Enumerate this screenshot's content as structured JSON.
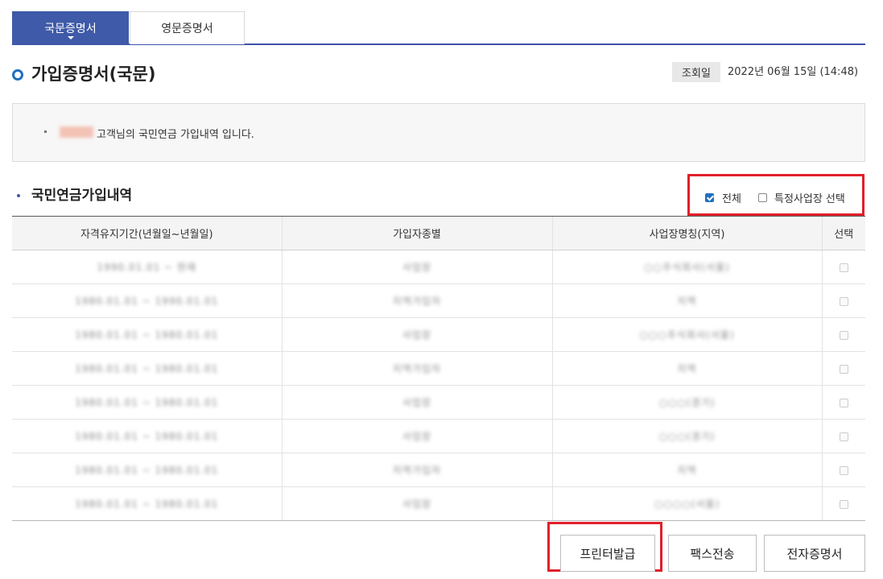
{
  "tabs": [
    {
      "label": "국문증명서",
      "active": true
    },
    {
      "label": "영문증명서",
      "active": false
    }
  ],
  "page_title": "가입증명서(국문)",
  "view": {
    "badge": "조회일",
    "date": "2022년 06월 15일 (14:48)"
  },
  "notice": {
    "message": "고객님의 국민연금 가입내역 입니다."
  },
  "section_title": "국민연금가입내역",
  "filters": {
    "all_label": "전체",
    "all_checked": true,
    "site_label": "특정사업장 선택",
    "site_checked": false
  },
  "table": {
    "headers": [
      "자격유지기간(년월일~년월일)",
      "가입자종별",
      "사업장명칭(지역)",
      "선택"
    ],
    "rows": [
      {
        "period": "1990.01.01 ~ 현재",
        "type": "사업장",
        "site": "○○주식회사(서울)"
      },
      {
        "period": "1980.01.01 ~ 1990.01.01",
        "type": "지역가입자",
        "site": "지역"
      },
      {
        "period": "1980.01.01 ~ 1980.01.01",
        "type": "사업장",
        "site": "○○○주식회사(서울)"
      },
      {
        "period": "1980.01.01 ~ 1980.01.01",
        "type": "지역가입자",
        "site": "지역"
      },
      {
        "period": "1980.01.01 ~ 1980.01.01",
        "type": "사업장",
        "site": "○○○(경기)"
      },
      {
        "period": "1980.01.01 ~ 1980.01.01",
        "type": "사업장",
        "site": "○○○(경기)"
      },
      {
        "period": "1980.01.01 ~ 1980.01.01",
        "type": "지역가입자",
        "site": "지역"
      },
      {
        "period": "1980.01.01 ~ 1980.01.01",
        "type": "사업장",
        "site": "○○○○(서울)"
      }
    ]
  },
  "buttons": {
    "print": "프린터발급",
    "fax": "팩스전송",
    "ecert": "전자증명서"
  },
  "colors": {
    "accent": "#3e5aa8",
    "highlight": "#e0202a"
  }
}
